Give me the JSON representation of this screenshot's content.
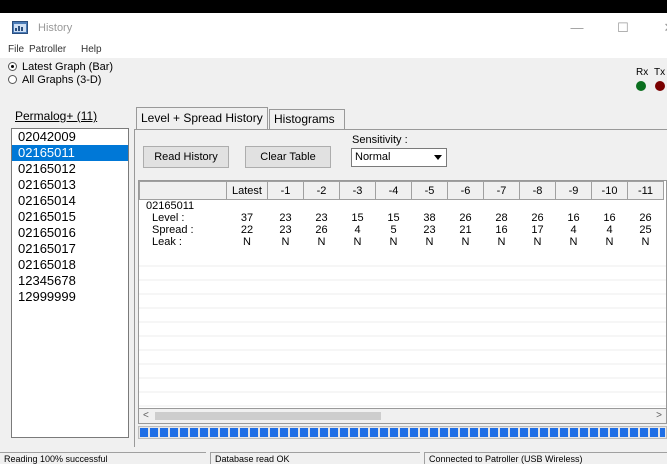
{
  "window": {
    "title": "History",
    "controls": {
      "minimize": "—",
      "maximize": "☐",
      "close": "✕"
    }
  },
  "menu": [
    "File",
    "Patroller",
    "Help"
  ],
  "graph_mode": {
    "options": [
      "Latest Graph (Bar)",
      "All Graphs (3-D)"
    ],
    "selected_index": 0
  },
  "indicators": {
    "rx": {
      "label": "Rx",
      "color": "#0a6e1e"
    },
    "tx": {
      "label": "Tx",
      "color": "#7a0000"
    }
  },
  "permalog": {
    "link_label": "Permalog+ (11)",
    "items": [
      "02042009",
      "02165011",
      "02165012",
      "02165013",
      "02165014",
      "02165015",
      "02165016",
      "02165017",
      "02165018",
      "12345678",
      "12999999"
    ],
    "selected_index": 1
  },
  "tabs": [
    {
      "label": "Level + Spread History",
      "active": true
    },
    {
      "label": "Histograms",
      "active": false
    }
  ],
  "buttons": {
    "read_history": "Read History",
    "clear_table": "Clear Table"
  },
  "sensitivity": {
    "label": "Sensitivity :",
    "value": "Normal"
  },
  "table": {
    "columns": [
      "",
      "Latest",
      "-1",
      "-2",
      "-3",
      "-4",
      "-5",
      "-6",
      "-7",
      "-8",
      "-9",
      "-10",
      "-11"
    ],
    "group_label": "02165011",
    "rows": [
      {
        "label": "Level :",
        "values": [
          "37",
          "23",
          "23",
          "15",
          "15",
          "38",
          "26",
          "28",
          "26",
          "16",
          "16",
          "26"
        ]
      },
      {
        "label": "Spread :",
        "values": [
          "22",
          "23",
          "26",
          "4",
          "5",
          "23",
          "21",
          "16",
          "17",
          "4",
          "4",
          "25"
        ]
      },
      {
        "label": "Leak :",
        "values": [
          "N",
          "N",
          "N",
          "N",
          "N",
          "N",
          "N",
          "N",
          "N",
          "N",
          "N",
          "N"
        ]
      }
    ]
  },
  "scroll_arrows": {
    "left": "<",
    "right": ">"
  },
  "progress": {
    "fraction": 1.0
  },
  "status": [
    "Reading 100% successful",
    "Database read OK",
    "Connected to Patroller (USB Wireless)"
  ],
  "colors": {
    "selection": "#0078d7",
    "progress": "#1e6ee6"
  }
}
